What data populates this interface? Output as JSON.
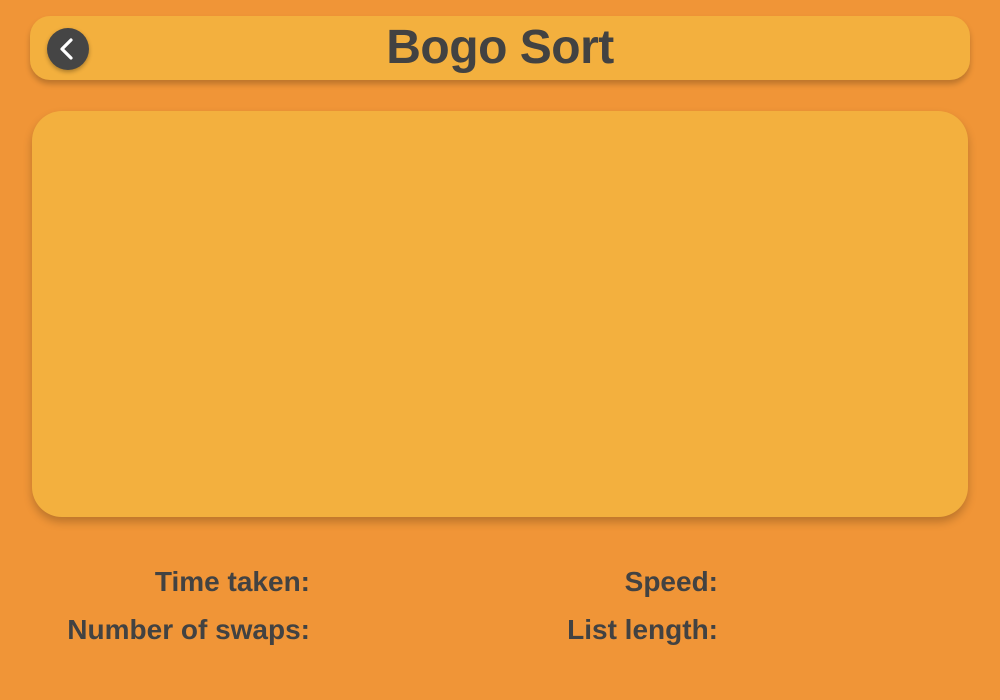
{
  "header": {
    "title": "Bogo Sort",
    "back_icon": "chevron-left-icon"
  },
  "stats": {
    "time_taken_label": "Time taken:",
    "number_of_swaps_label": "Number of swaps:",
    "speed_label": "Speed:",
    "list_length_label": "List length:"
  },
  "colors": {
    "background": "#f09537",
    "panel": "#f3b03e",
    "text": "#424242",
    "back_button": "#454545"
  }
}
